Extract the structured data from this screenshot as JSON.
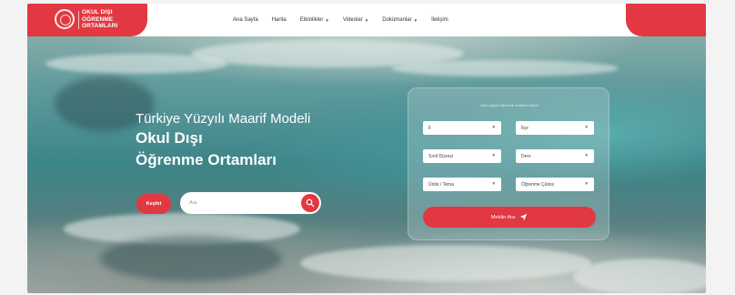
{
  "logo": {
    "line1": "OKUL DIŞI",
    "line2": "ÖĞRENME",
    "line3": "ORTAMLARI"
  },
  "nav": {
    "items": [
      {
        "label": "Ana Sayfa",
        "has_dropdown": false
      },
      {
        "label": "Harita",
        "has_dropdown": false
      },
      {
        "label": "Etkinlikler",
        "has_dropdown": true
      },
      {
        "label": "Videolar",
        "has_dropdown": true
      },
      {
        "label": "Dokümanlar",
        "has_dropdown": true
      },
      {
        "label": "İletişim",
        "has_dropdown": false
      }
    ]
  },
  "hero": {
    "subtitle": "Türkiye Yüzyılı Maarif Modeli",
    "title_line1": "Okul Dışı",
    "title_line2": "Öğrenme Ortamları"
  },
  "search": {
    "explore_label": "Keşfet",
    "placeholder": "Ara"
  },
  "filter_panel": {
    "title": "Size uygun öğrenme ortamını bulun",
    "selects": {
      "il": "İl",
      "ilce": "İlçe",
      "sinif": "Sınıf Düzeyi",
      "ders": "Ders",
      "unite": "Ünite / Tema",
      "cikti": "Öğrenme Çıktısı"
    },
    "find_button": "Mekân Ara"
  },
  "colors": {
    "accent": "#e23842",
    "nav_bg": "#ffffff"
  }
}
